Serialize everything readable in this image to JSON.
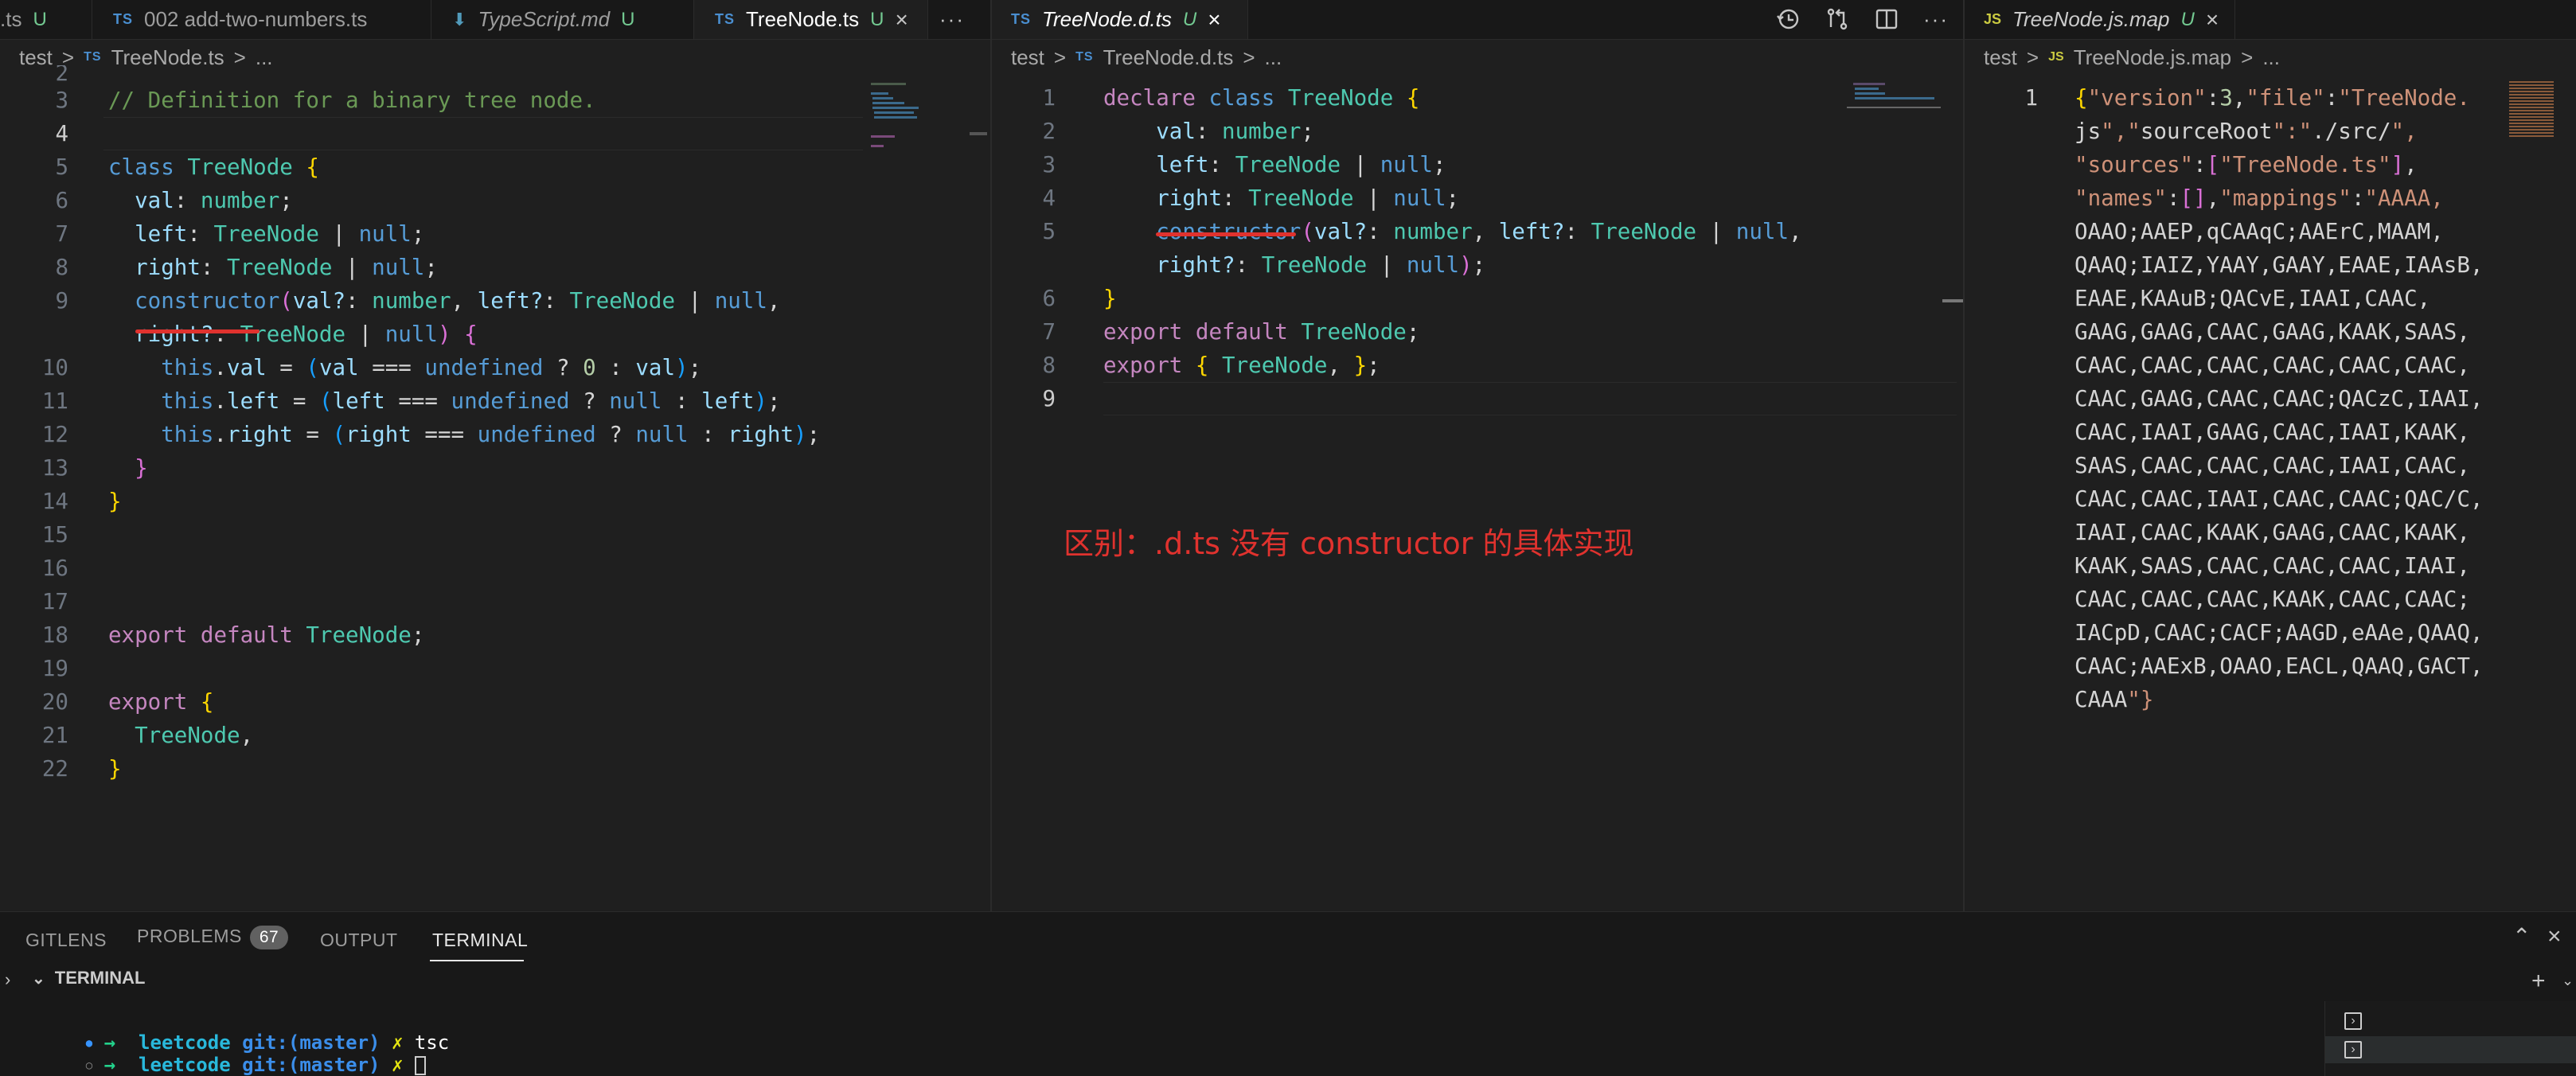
{
  "pane1": {
    "tabs": [
      {
        "label": ".ts",
        "modified": "U"
      },
      {
        "label": "002 add-two-numbers.ts",
        "icon": "TS"
      },
      {
        "label": "TypeScript.md",
        "modified": "U"
      },
      {
        "label": "TreeNode.ts",
        "icon": "TS",
        "modified": "U",
        "close": "×"
      }
    ],
    "more": "···",
    "breadcrumb": {
      "folder": "test",
      "sep": ">",
      "icon": "TS",
      "file": "TreeNode.ts",
      "tail": "..."
    },
    "line_numbers": [
      "2",
      "3",
      "4",
      "5",
      "6",
      "7",
      "8",
      "9",
      "",
      "10",
      "11",
      "12",
      "13",
      "14",
      "15",
      "16",
      "17",
      "18",
      "19",
      "20",
      "21",
      "22"
    ]
  },
  "pane2": {
    "tab": {
      "label": "TreeNode.d.ts",
      "icon": "TS",
      "modified": "U",
      "close": "×"
    },
    "breadcrumb": {
      "folder": "test",
      "sep": ">",
      "icon": "TS",
      "file": "TreeNode.d.ts",
      "tail": "..."
    },
    "line_numbers": [
      "1",
      "2",
      "3",
      "4",
      "5",
      "",
      "6",
      "7",
      "8",
      "9"
    ],
    "annotation": "区别：.d.ts 没有 constructor 的具体实现"
  },
  "pane3": {
    "tab": {
      "label": "TreeNode.js.map",
      "icon": "JS",
      "modified": "U",
      "close": "×"
    },
    "breadcrumb": {
      "folder": "test",
      "sep": ">",
      "icon": "JS",
      "file": "TreeNode.js.map",
      "tail": "..."
    },
    "line_number": "1",
    "lines": [
      "{\"version\":3,\"file\":\"TreeNode.",
      "js\",\"sourceRoot\":\"./src/\",",
      "\"sources\":[\"TreeNode.ts\"],",
      "\"names\":[],\"mappings\":\"AAAA,",
      "OAAO;AAEP,qCAAqC;AAErC,MAAM,",
      "QAAQ;IAIZ,YAAY,GAAY,EAAE,IAAsB,",
      "EAAE,KAAuB;QACvE,IAAI,CAAC,",
      "GAAG,GAAG,CAAC,GAAG,KAAK,SAAS,",
      "CAAC,CAAC,CAAC,CAAC,CAAC,CAAC,",
      "CAAC,GAAG,CAAC,CAAC;QACzC,IAAI,",
      "CAAC,IAAI,GAAG,CAAC,IAAI,KAAK,",
      "SAAS,CAAC,CAAC,CAAC,IAAI,CAAC,",
      "CAAC,CAAC,IAAI,CAAC,CAAC;QAC/C,",
      "IAAI,CAAC,KAAK,GAAG,CAAC,KAAK,",
      "KAAK,SAAS,CAAC,CAAC,CAAC,IAAI,",
      "CAAC,CAAC,CAAC,KAAK,CAAC,CAAC;",
      "IACpD,CAAC;CACF;AAGD,eAAe,QAAQ,",
      "CAAC;AAExB,OAAO,EACL,QAAQ,GACT,",
      "CAAA\"}"
    ]
  },
  "panel": {
    "tabs": [
      "GITLENS",
      "PROBLEMS",
      "OUTPUT",
      "TERMINAL"
    ],
    "problems_count": "67",
    "section_title": "TERMINAL",
    "terminal_lines": [
      {
        "prompt": "→",
        "dir": "leetcode",
        "git": "git:(master)",
        "x": "✗",
        "cmd": "tsc"
      },
      {
        "prompt": "→",
        "dir": "leetcode",
        "git": "git:(master)",
        "x": "✗",
        "cmd": ""
      }
    ]
  },
  "colors": {
    "accent_red": "#e0322e",
    "keyword": "#569cd6",
    "class": "#4ec9b0",
    "string": "#ce9178",
    "comment": "#6a9955"
  }
}
